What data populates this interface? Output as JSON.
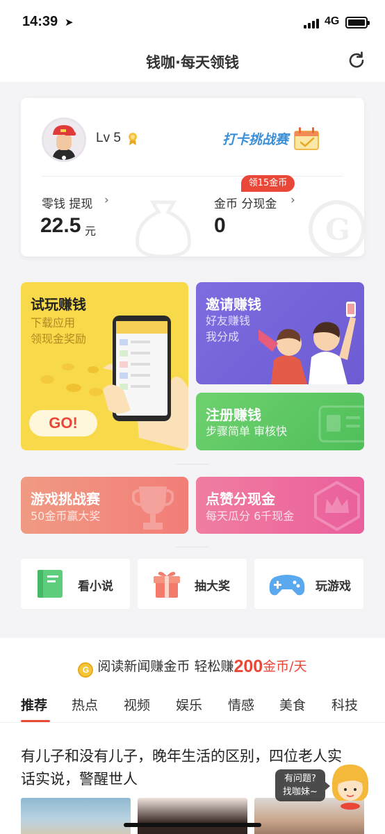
{
  "status_bar": {
    "time": "14:39",
    "network": "4G"
  },
  "nav": {
    "title": "钱咖·每天领钱",
    "refresh_icon": "refresh-icon"
  },
  "user_card": {
    "level": "Lv 5",
    "challenge_logo": "打卡挑战赛",
    "cash": {
      "label": "零钱 提现",
      "value": "22.5",
      "unit": "元"
    },
    "coins": {
      "label": "金币 分现金",
      "value": "0",
      "badge": "领15金币"
    }
  },
  "earn_tiles": {
    "try": {
      "title": "试玩赚钱",
      "sub1": "下载应用",
      "sub2": "领现金奖励",
      "button": "GO!"
    },
    "invite": {
      "title": "邀请赚钱",
      "sub1": "好友赚钱",
      "sub2": "我分成"
    },
    "register": {
      "title": "注册赚钱",
      "sub": "步骤简单 审核快"
    },
    "game": {
      "title": "游戏挑战赛",
      "sub": "50金币赢大奖"
    },
    "like": {
      "title": "点赞分现金",
      "sub": "每天瓜分 6千现金"
    }
  },
  "quick_links": [
    {
      "label": "看小说",
      "icon": "book-icon"
    },
    {
      "label": "抽大奖",
      "icon": "gift-icon"
    },
    {
      "label": "玩游戏",
      "icon": "gamepad-icon"
    }
  ],
  "feed": {
    "promo_prefix": "阅读新闻赚金币 轻松赚",
    "promo_amount": "200",
    "promo_suffix": "金币/天",
    "promo_coin": "G",
    "tabs": [
      "推荐",
      "热点",
      "视频",
      "娱乐",
      "情感",
      "美食",
      "科技"
    ],
    "active_tab": "推荐",
    "headline": "有儿子和没有儿子，晚年生活的区别，四位老人实话实说，警醒世人"
  },
  "helper": {
    "line1": "有问题?",
    "line2": "找咖妹~"
  },
  "colors": {
    "accent": "#e94738",
    "try_bg": "#f8d94a",
    "invite_bg": "#7d6de0",
    "register_bg": "#5cc863",
    "game_bg": "#f28a7c",
    "like_bg": "#ec6b9f"
  }
}
